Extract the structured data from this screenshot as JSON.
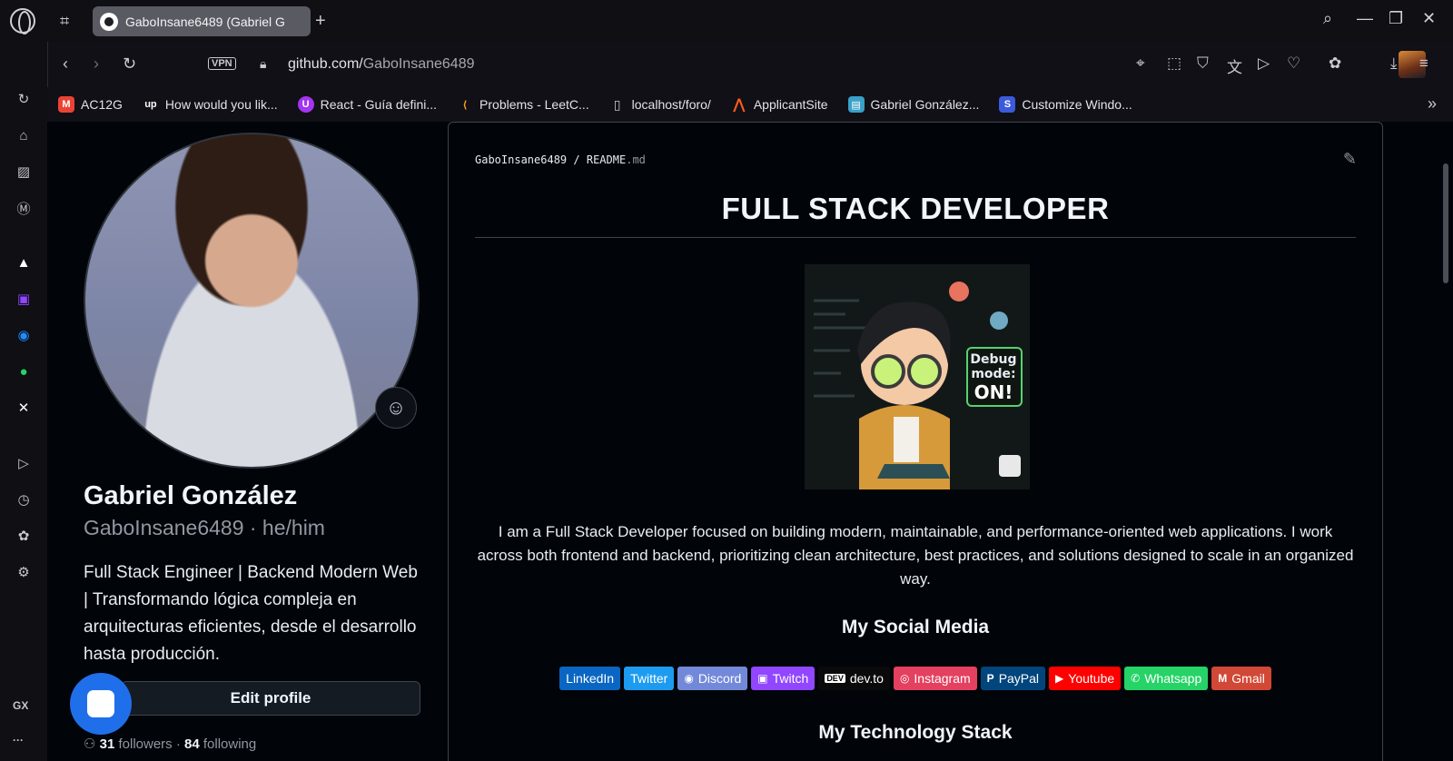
{
  "browser": {
    "tab": {
      "title": "GaboInsane6489 (Gabriel G",
      "icon": "github-icon"
    },
    "address": {
      "vpn_label": "VPN",
      "domain": "github.com/",
      "path": "GaboInsane6489"
    },
    "bookmarks": [
      {
        "label": "AC12G",
        "icon": "gmail-icon",
        "color": "#ea4335",
        "glyph": "M"
      },
      {
        "label": "How would you lik...",
        "icon": "upwork-icon",
        "color": "#101016",
        "glyph": "up"
      },
      {
        "label": "React - Guía defini...",
        "icon": "udemy-icon",
        "color": "#a435f0",
        "glyph": "U"
      },
      {
        "label": "Problems - LeetC...",
        "icon": "leetcode-icon",
        "color": "#101016",
        "glyph": "⟨"
      },
      {
        "label": "localhost/foro/",
        "icon": "page-icon",
        "color": "#101016",
        "glyph": "▢"
      },
      {
        "label": "ApplicantSite",
        "icon": "applicant-icon",
        "color": "#ff5a1f",
        "glyph": "⋀"
      },
      {
        "label": "Gabriel González...",
        "icon": "profile-icon",
        "color": "#3aa0c8",
        "glyph": "▤"
      },
      {
        "label": "Customize Windo...",
        "icon": "windows-icon",
        "color": "#3b5bdb",
        "glyph": "S"
      }
    ]
  },
  "profile": {
    "name": "Gabriel González",
    "handle": "GaboInsane6489 · he/him",
    "bio": "Full Stack Engineer | Backend Modern Web | Transformando lógica compleja en arquitecturas eficientes, desde el desarrollo hasta producción.",
    "edit_button": "Edit profile",
    "followers_count": "31",
    "followers_label": "followers ·",
    "following_count": "84",
    "following_label": "following"
  },
  "readme": {
    "path_user": "GaboInsane6489",
    "path_sep": "/",
    "path_file": "README",
    "path_ext": ".md",
    "title": "FULL STACK DEVELOPER",
    "image_text": {
      "line1": "Debug",
      "line2": "mode:",
      "line3": "ON!"
    },
    "intro": "I am a Full Stack Developer focused on building modern, maintainable, and performance-oriented web applications. I work across both frontend and backend, prioritizing clean architecture, best practices, and solutions designed to scale in an organized way.",
    "social_heading": "My Social Media",
    "social": [
      {
        "label": "LinkedIn",
        "color": "#0a66c2",
        "glyph": ""
      },
      {
        "label": "Twitter",
        "color": "#1d9bf0",
        "glyph": ""
      },
      {
        "label": "Discord",
        "color": "#7289da",
        "glyph": "◉"
      },
      {
        "label": "Twitch",
        "color": "#9146ff",
        "glyph": "▣"
      },
      {
        "label": "dev.to",
        "color": "#0a0a0a",
        "glyph": "DEV"
      },
      {
        "label": "Instagram",
        "color": "#e4405f",
        "glyph": "◎"
      },
      {
        "label": "PayPal",
        "color": "#00457c",
        "glyph": "P"
      },
      {
        "label": "Youtube",
        "color": "#ff0000",
        "glyph": "▶"
      },
      {
        "label": "Whatsapp",
        "color": "#25d366",
        "glyph": "✆"
      },
      {
        "label": "Gmail",
        "color": "#d14836",
        "glyph": "M"
      }
    ],
    "tech_heading": "My Technology Stack"
  },
  "sidebar": {
    "items": [
      "flow-icon",
      "aria-icon",
      "news-icon",
      "mail-icon",
      "aria-ai-icon",
      "twitch-icon",
      "messenger-icon",
      "whatsapp-icon",
      "x-icon",
      "player-icon",
      "history-icon",
      "extensions-icon",
      "settings-icon"
    ],
    "gx_label": "GX",
    "more_label": "···"
  }
}
